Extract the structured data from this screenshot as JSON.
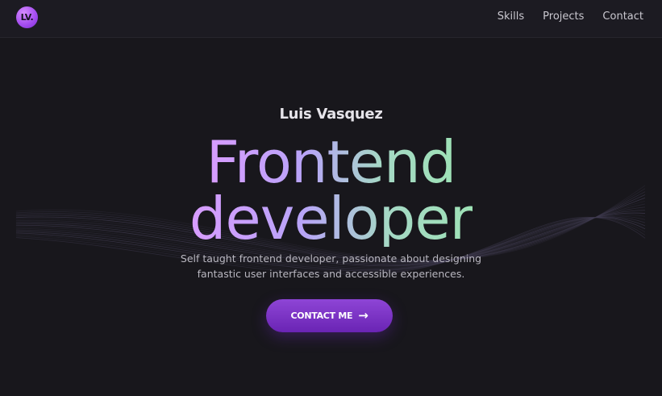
{
  "nav": {
    "logo": "LV.",
    "links": [
      "Skills",
      "Projects",
      "Contact"
    ]
  },
  "hero": {
    "name": "Luis Vasquez",
    "headline_line1": "Frontend",
    "headline_line2": "developer",
    "tagline_line1": "Self taught frontend developer, passionate about designing",
    "tagline_line2": "fantastic user interfaces and accessible experiences.",
    "cta_label": "CONTACT ME",
    "cta_icon": "arrow-right-icon"
  },
  "colors": {
    "background": "#18171c",
    "accent": "#8e45d6",
    "gradient_start": "#d89cff",
    "gradient_end": "#9ee2b6"
  }
}
